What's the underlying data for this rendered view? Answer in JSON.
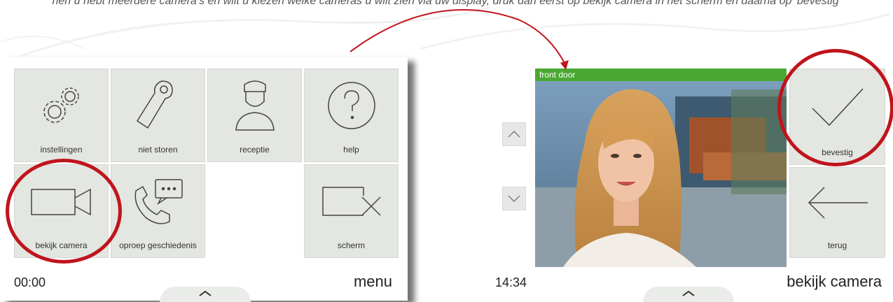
{
  "instruction_text": "hen u hebt meerdere camera’s en wilt u kiezen welke cameras u wilt zien via uw display, druk dan eerst op bekijk camera in het scherm en daarna op 'bevestig'",
  "left_screen": {
    "tiles": [
      {
        "label": "instellingen",
        "icon": "gears-icon"
      },
      {
        "label": "niet storen",
        "icon": "door-hanger-icon"
      },
      {
        "label": "receptie",
        "icon": "receptionist-icon"
      },
      {
        "label": "help",
        "icon": "question-icon"
      },
      {
        "label": "bekijk camera",
        "icon": "camera-icon"
      },
      {
        "label": "oproep geschiedenis",
        "icon": "call-history-icon"
      },
      {
        "label": "scherm",
        "icon": "screen-off-icon"
      }
    ],
    "clock": "00:00",
    "title": "menu"
  },
  "right_screen": {
    "camera_name": "front door",
    "clock": "14:34",
    "title": "bekijk camera",
    "confirm_label": "bevestig",
    "back_label": "terug"
  },
  "colors": {
    "highlight": "#c0141c",
    "camera_header": "#4aa832",
    "tile_bg": "#e3e6e1"
  }
}
